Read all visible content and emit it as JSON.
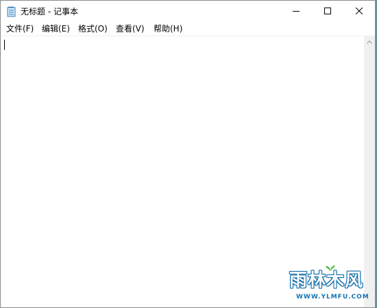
{
  "window": {
    "title": "无标题 - 记事本"
  },
  "menu": [
    {
      "label": "文件(F)"
    },
    {
      "label": "编辑(E)"
    },
    {
      "label": "格式(O)"
    },
    {
      "label": "查看(V)"
    },
    {
      "label": "帮助(H)"
    }
  ],
  "editor": {
    "content": ""
  },
  "watermark": {
    "text": "雨林木风",
    "url": "WWW.YLMFU.COM"
  },
  "icons": {
    "app": "notepad-icon",
    "minimize": "minimize-icon",
    "maximize": "maximize-icon",
    "close": "close-icon",
    "scroll_up": "chevron-up-icon"
  },
  "colors": {
    "window_bg": "#ffffff",
    "scrollbar_bg": "#f0f0f0",
    "desktop": "#7fa3b5",
    "watermark_blue": "#1473b6"
  }
}
